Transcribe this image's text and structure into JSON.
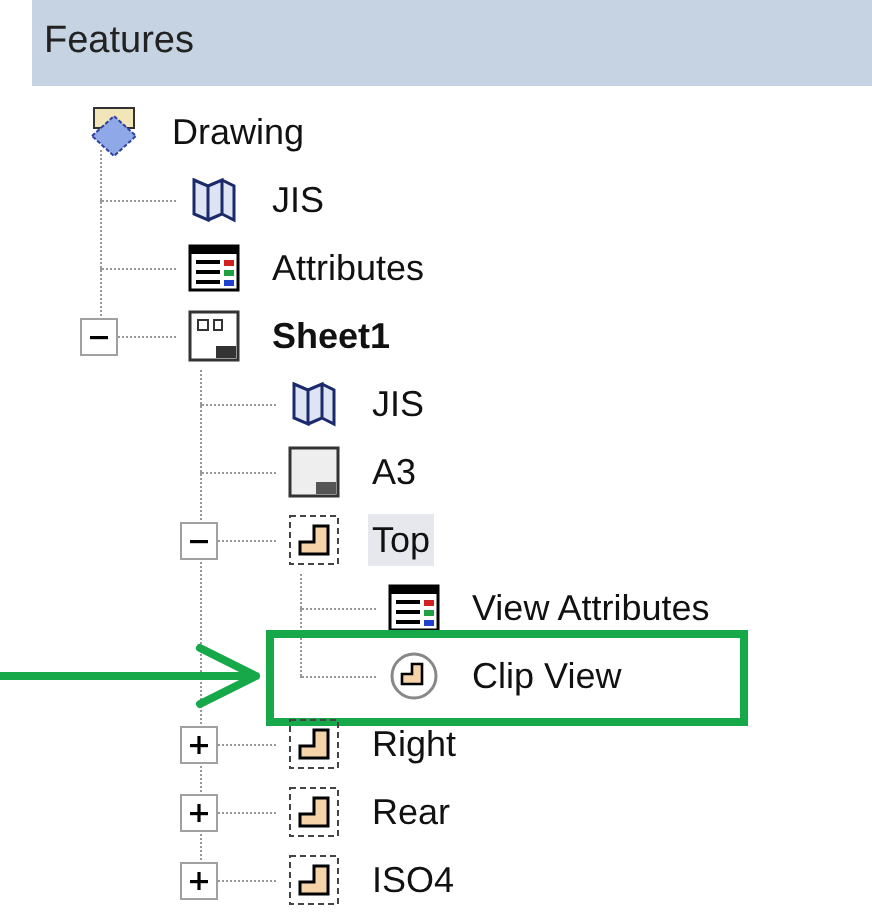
{
  "panel": {
    "title": "Features"
  },
  "tree": [
    {
      "label": "Drawing",
      "kind": "drawing",
      "selected": false,
      "active": false,
      "callout": false,
      "children": [
        {
          "label": "JIS",
          "kind": "standard",
          "selected": false,
          "active": false,
          "callout": false
        },
        {
          "label": "Attributes",
          "kind": "attributes",
          "selected": false,
          "active": false,
          "callout": false
        },
        {
          "label": "Sheet1",
          "kind": "sheet",
          "selected": false,
          "active": true,
          "callout": false,
          "expanded": true,
          "children": [
            {
              "label": "JIS",
              "kind": "standard",
              "selected": false,
              "active": false,
              "callout": false
            },
            {
              "label": "A3",
              "kind": "paper",
              "selected": false,
              "active": false,
              "callout": false
            },
            {
              "label": "Top",
              "kind": "view",
              "selected": true,
              "active": false,
              "callout": false,
              "expanded": true,
              "children": [
                {
                  "label": "View Attributes",
                  "kind": "attributes",
                  "selected": false,
                  "active": false,
                  "callout": false
                },
                {
                  "label": "Clip View",
                  "kind": "clip",
                  "selected": false,
                  "active": false,
                  "callout": true
                }
              ]
            },
            {
              "label": "Right",
              "kind": "view",
              "selected": false,
              "active": false,
              "callout": false,
              "expanded": false
            },
            {
              "label": "Rear",
              "kind": "view",
              "selected": false,
              "active": false,
              "callout": false,
              "expanded": false
            },
            {
              "label": "ISO4",
              "kind": "view",
              "selected": false,
              "active": false,
              "callout": false,
              "expanded": false
            }
          ]
        }
      ]
    }
  ]
}
